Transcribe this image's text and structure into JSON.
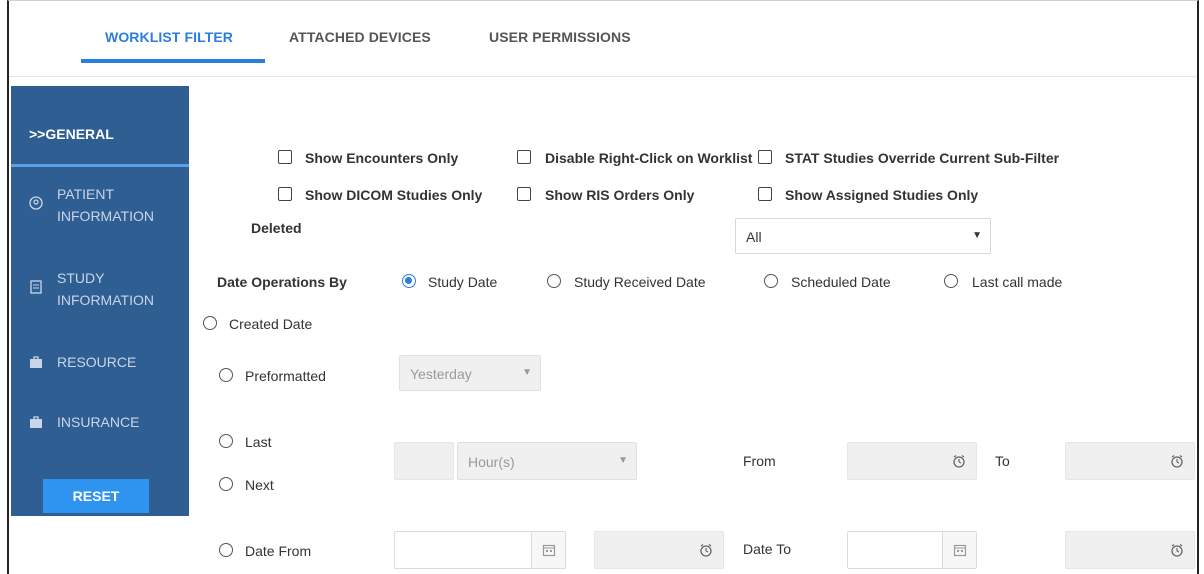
{
  "tabs": [
    {
      "label": "WORKLIST FILTER",
      "active": true
    },
    {
      "label": "ATTACHED DEVICES",
      "active": false
    },
    {
      "label": "USER PERMISSIONS",
      "active": false
    }
  ],
  "sidebar": {
    "items": [
      {
        "label": ">>GENERAL",
        "icon": ""
      },
      {
        "label_line1": "PATIENT",
        "label_line2": "INFORMATION",
        "icon": "patient-icon"
      },
      {
        "label_line1": "STUDY",
        "label_line2": "INFORMATION",
        "icon": "study-icon"
      },
      {
        "label": "RESOURCE",
        "icon": "briefcase-icon"
      },
      {
        "label": "INSURANCE",
        "icon": "briefcase-icon"
      }
    ],
    "reset_label": "RESET"
  },
  "checkboxes": {
    "show_encounters": "Show Encounters Only",
    "disable_right_click": "Disable Right-Click on Worklist",
    "stat_override": "STAT Studies Override Current Sub-Filter",
    "show_dicom": "Show DICOM Studies Only",
    "show_ris": "Show RIS Orders Only",
    "show_assigned": "Show Assigned Studies Only"
  },
  "deleted": {
    "label": "Deleted",
    "value": "All"
  },
  "date_ops": {
    "label": "Date Operations By",
    "options": [
      "Study Date",
      "Study Received Date",
      "Scheduled Date",
      "Last call made",
      "Created Date"
    ],
    "selected": "Study Date"
  },
  "preformatted": {
    "label": "Preformatted",
    "value": "Yesterday"
  },
  "last_next": {
    "last": "Last",
    "next": "Next",
    "unit": "Hour(s)",
    "from": "From",
    "to": "To"
  },
  "date_range": {
    "from_label": "Date From",
    "to_label": "Date To"
  },
  "colors": {
    "accent": "#2b7de0",
    "sidebar_bg": "#2f5e93",
    "reset_bg": "#2f93f0"
  }
}
